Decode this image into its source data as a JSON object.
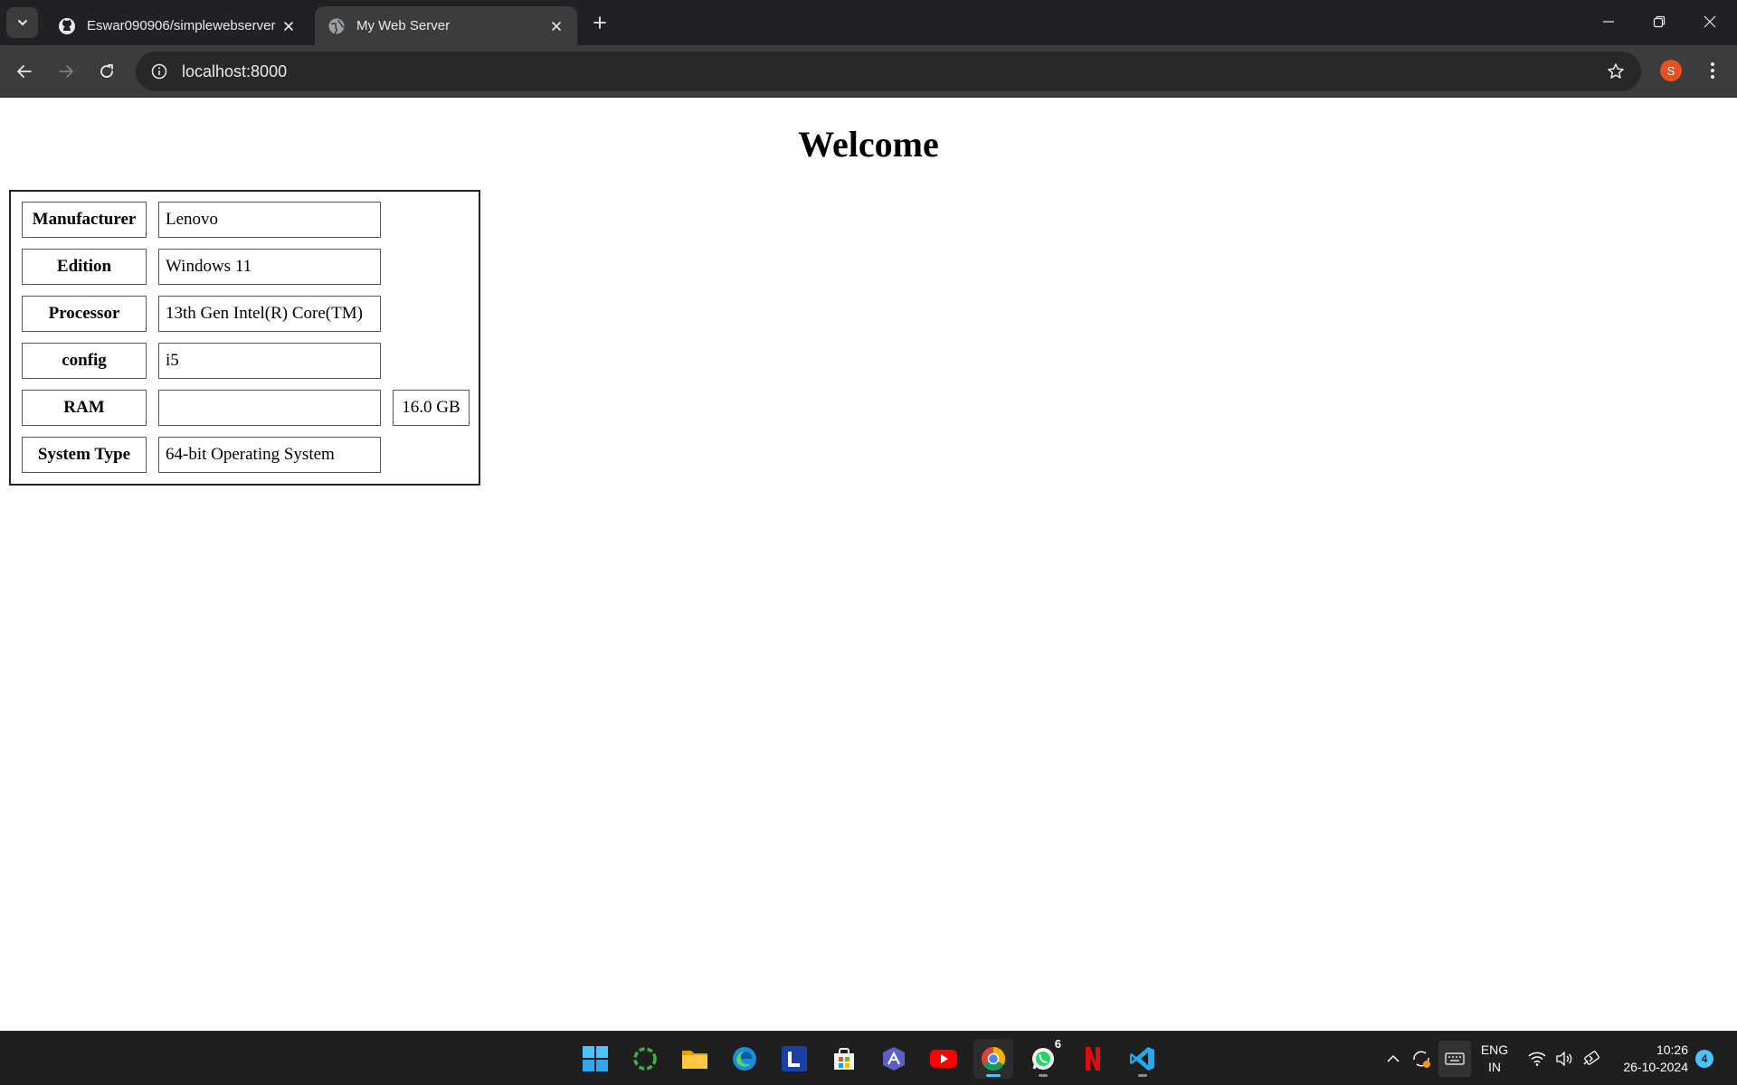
{
  "browser": {
    "tabs": [
      {
        "title": "Eswar090906/simplewebserver",
        "favicon": "github-icon",
        "active": false
      },
      {
        "title": "My Web Server",
        "favicon": "globe-icon",
        "active": true
      }
    ],
    "address": "localhost:8000",
    "profile_initial": "S"
  },
  "page": {
    "heading": "Welcome",
    "rows": [
      {
        "label": "Manufacturer",
        "value": "Lenovo"
      },
      {
        "label": "Edition",
        "value": "Windows 11"
      },
      {
        "label": "Processor",
        "value": "13th Gen Intel(R) Core(TM)"
      },
      {
        "label": "config",
        "value": "i5"
      },
      {
        "label": "RAM",
        "value": "",
        "extra": "16.0 GB"
      },
      {
        "label": "System Type",
        "value": "64-bit Operating System"
      }
    ]
  },
  "taskbar": {
    "apps": [
      "windows-start-icon",
      "sync-app-icon",
      "file-explorer-icon",
      "edge-icon",
      "l-app-icon",
      "microsoft-store-icon",
      "arc-app-icon",
      "youtube-icon",
      "chrome-icon",
      "whatsapp-icon",
      "netflix-icon",
      "vscode-icon"
    ],
    "whatsapp_badge": "6",
    "language": "ENG",
    "region": "IN",
    "time": "10:26",
    "date": "26-10-2024",
    "notification_count": "4"
  },
  "colors": {
    "tabstrip": "#202124",
    "toolbar": "#3c3c3c",
    "omnibox": "#282828",
    "profile": "#e8501c",
    "taskbar": "#1f1f1f",
    "accent": "#4cc2ff"
  }
}
